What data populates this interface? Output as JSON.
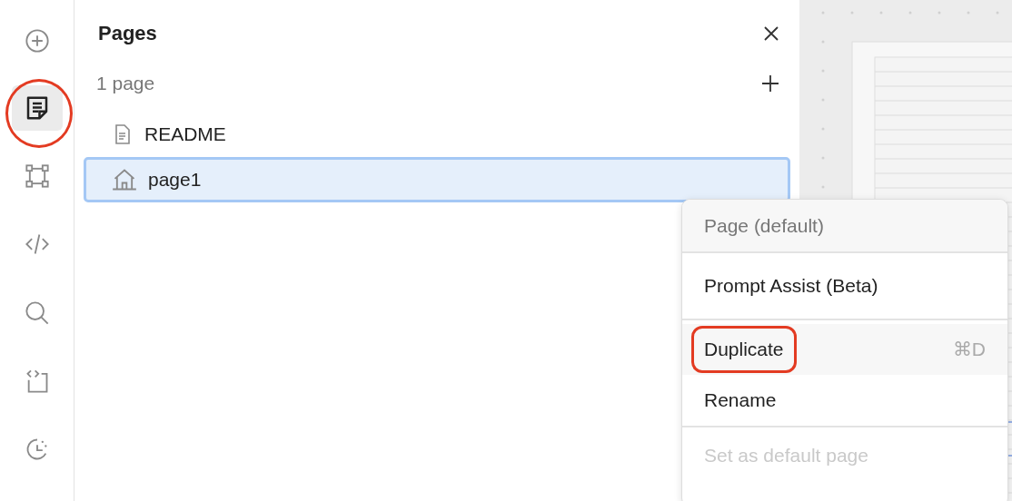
{
  "rail": [
    {
      "selected": false,
      "annotated": false
    },
    {
      "selected": true,
      "annotated": true
    },
    {
      "selected": false,
      "annotated": false
    },
    {
      "selected": false,
      "annotated": false
    },
    {
      "selected": false,
      "annotated": false
    },
    {
      "selected": false,
      "annotated": false
    },
    {
      "selected": false,
      "annotated": false
    }
  ],
  "panel": {
    "title": "Pages",
    "count": "1 page"
  },
  "pages": [
    {
      "label": "README",
      "selected": false
    },
    {
      "label": "page1",
      "selected": true
    }
  ],
  "menu": [
    {
      "kind": "header",
      "label": "Page (default)"
    },
    {
      "kind": "divider"
    },
    {
      "kind": "item",
      "label": "Prompt Assist (Beta)",
      "highlighted": false,
      "annotated": false
    },
    {
      "kind": "divider"
    },
    {
      "kind": "item",
      "label": "Duplicate",
      "shortcut": "⌘D",
      "highlighted": true,
      "annotated": true
    },
    {
      "kind": "item",
      "label": "Rename",
      "highlighted": false,
      "annotated": false
    },
    {
      "kind": "divider"
    },
    {
      "kind": "disabled",
      "label": "Set as default page"
    }
  ]
}
